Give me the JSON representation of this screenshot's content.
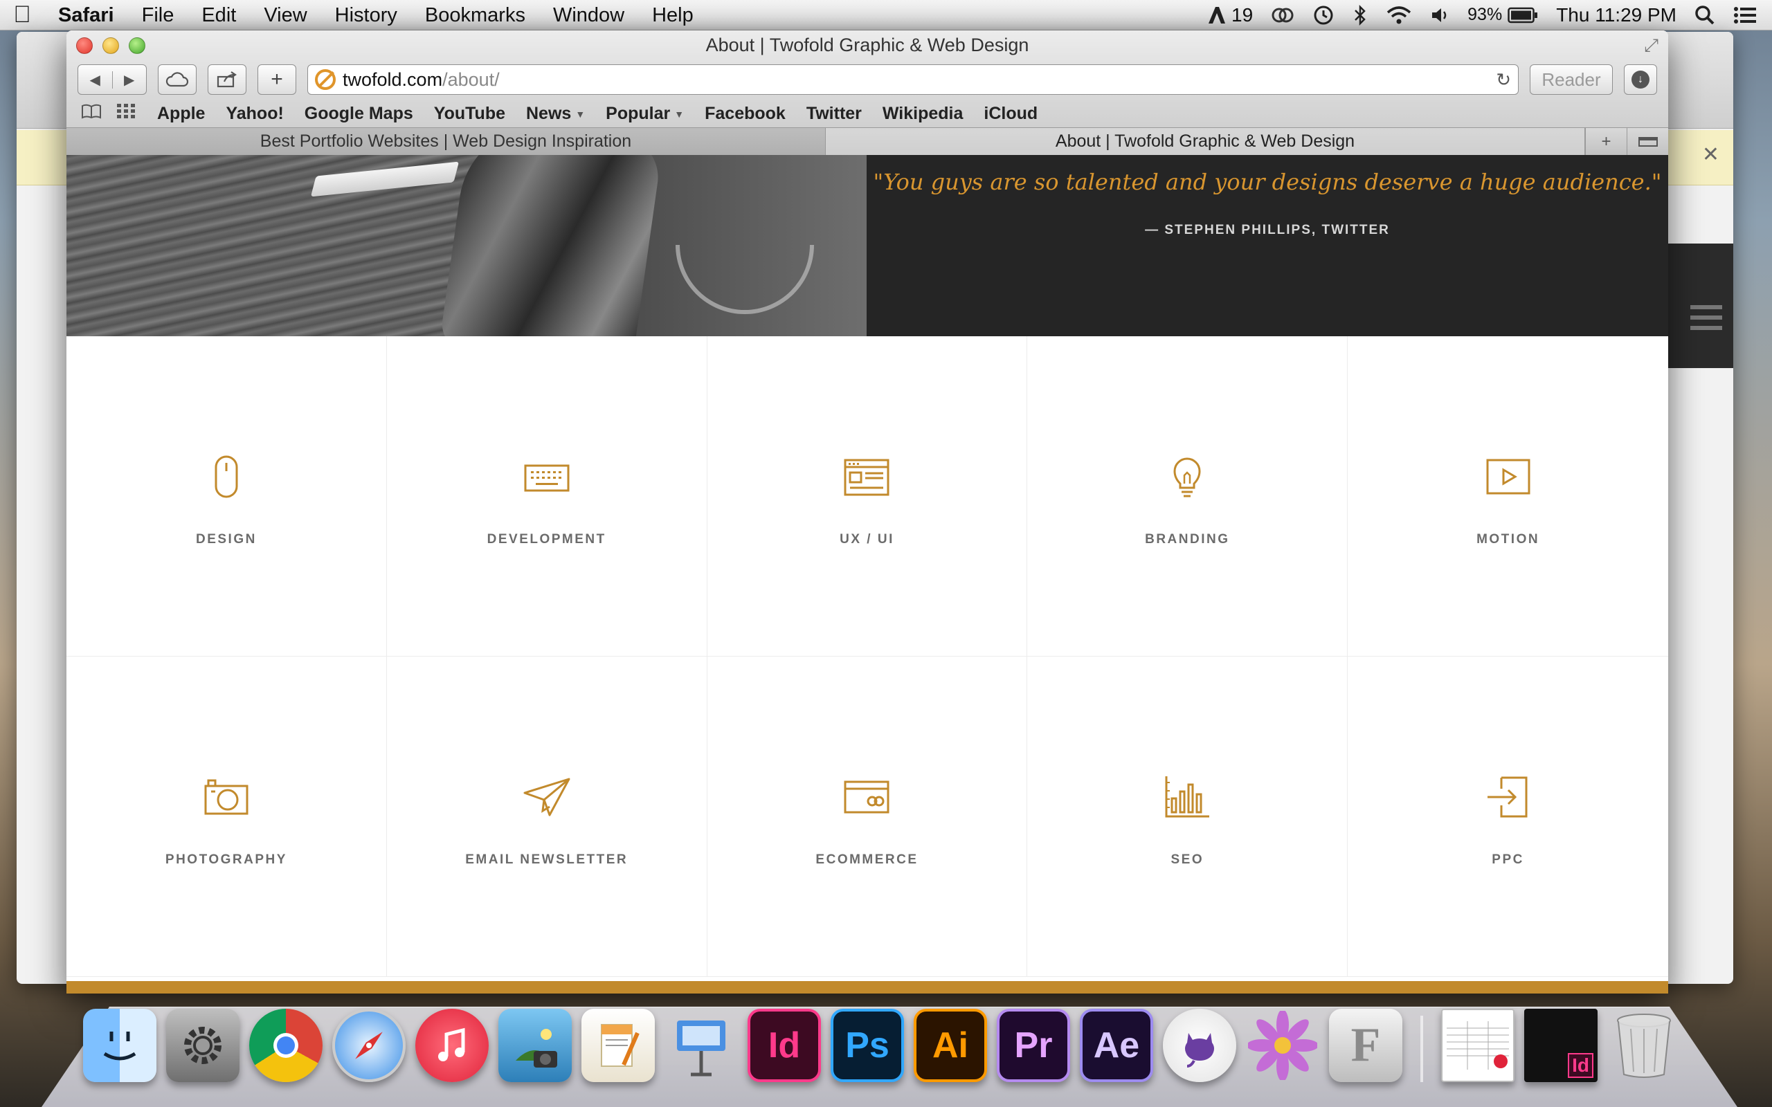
{
  "menubar": {
    "app_name": "Safari",
    "menus": [
      "File",
      "Edit",
      "View",
      "History",
      "Bookmarks",
      "Window",
      "Help"
    ],
    "status": {
      "adobe_count": "19",
      "battery": "93%",
      "clock": "Thu 11:29 PM"
    }
  },
  "window": {
    "title": "About | Twofold Graphic & Web Design"
  },
  "toolbar": {
    "address_domain": "twofold.com",
    "address_path": "/about/",
    "reader_label": "Reader"
  },
  "bookmarks": [
    {
      "label": "Apple"
    },
    {
      "label": "Yahoo!"
    },
    {
      "label": "Google Maps"
    },
    {
      "label": "YouTube"
    },
    {
      "label": "News",
      "menu": true
    },
    {
      "label": "Popular",
      "menu": true
    },
    {
      "label": "Facebook"
    },
    {
      "label": "Twitter"
    },
    {
      "label": "Wikipedia"
    },
    {
      "label": "iCloud"
    }
  ],
  "tabs": [
    {
      "label": "Best Portfolio Websites | Web Design Inspiration",
      "active": false
    },
    {
      "label": "About | Twofold Graphic & Web Design",
      "active": true
    }
  ],
  "hero": {
    "quote": "\"You guys are so talented and your designs deserve a huge audience.\"",
    "author": "— STEPHEN PHILLIPS, TWITTER"
  },
  "services": [
    {
      "label": "DESIGN",
      "icon": "mouse-icon"
    },
    {
      "label": "DEVELOPMENT",
      "icon": "keyboard-icon"
    },
    {
      "label": "UX / UI",
      "icon": "wireframe-icon"
    },
    {
      "label": "BRANDING",
      "icon": "lightbulb-icon"
    },
    {
      "label": "MOTION",
      "icon": "play-icon"
    },
    {
      "label": "PHOTOGRAPHY",
      "icon": "camera-icon"
    },
    {
      "label": "EMAIL NEWSLETTER",
      "icon": "paper-plane-icon"
    },
    {
      "label": "ECOMMERCE",
      "icon": "credit-card-icon"
    },
    {
      "label": "SEO",
      "icon": "bar-chart-icon"
    },
    {
      "label": "PPC",
      "icon": "sign-in-icon"
    }
  ],
  "dock": [
    {
      "name": "Finder",
      "icon": "finder-icon"
    },
    {
      "name": "System Preferences",
      "icon": "gear-icon"
    },
    {
      "name": "Chrome",
      "icon": "chrome-icon"
    },
    {
      "name": "Safari",
      "icon": "compass-icon"
    },
    {
      "name": "iTunes",
      "icon": "music-note-icon"
    },
    {
      "name": "iPhoto",
      "icon": "photo-icon"
    },
    {
      "name": "Pages",
      "icon": "pages-icon"
    },
    {
      "name": "Keynote",
      "icon": "keynote-icon"
    },
    {
      "name": "InDesign",
      "icon": "indesign-icon",
      "text": "Id"
    },
    {
      "name": "Photoshop",
      "icon": "photoshop-icon",
      "text": "Ps"
    },
    {
      "name": "Illustrator",
      "icon": "illustrator-icon",
      "text": "Ai"
    },
    {
      "name": "Premiere",
      "icon": "premiere-icon",
      "text": "Pr"
    },
    {
      "name": "After Effects",
      "icon": "after-effects-icon",
      "text": "Ae"
    },
    {
      "name": "GitHub",
      "icon": "github-icon"
    },
    {
      "name": "Flower app",
      "icon": "flower-icon"
    },
    {
      "name": "Font Book",
      "icon": "font-book-icon",
      "text": "F"
    },
    {
      "name": "Spreadsheet window",
      "icon": "spreadsheet-thumb-icon"
    },
    {
      "name": "InDesign window",
      "icon": "indesign-thumb-icon",
      "text": "Id"
    },
    {
      "name": "Trash",
      "icon": "trash-icon"
    }
  ],
  "colors": {
    "accent_gold": "#c28a2c",
    "quote_gold": "#d9962f",
    "hero_dark": "#252525",
    "label_gray": "#6b6b6b"
  }
}
